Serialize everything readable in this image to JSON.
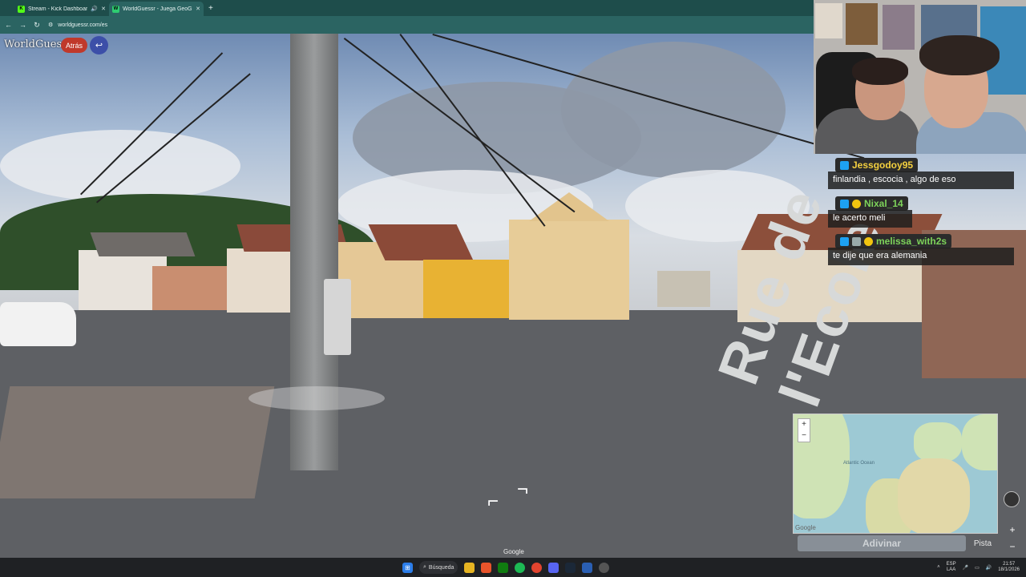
{
  "browser": {
    "tabs": [
      {
        "label": "Stream - Kick Dashboard",
        "favicon": "K",
        "favicon_color": "#53fc18",
        "active": false
      },
      {
        "label": "WorldGuessr - Juega GeoGuessr",
        "favicon": "W",
        "favicon_color": "#2ecc71",
        "active": true
      }
    ],
    "new_tab": "+",
    "url": "worldguessr.com/es"
  },
  "game": {
    "logo": "WorldGuessr",
    "back_label": "Atrás",
    "undo_icon": "↩",
    "street_name": "Rue de l'Ecole",
    "google_watermark": "Google",
    "guess_label": "Adivinar",
    "hint_label": "Pista",
    "map_attribution": "Google",
    "zoom_in": "+",
    "zoom_out": "−",
    "map_labels": [
      "Atlantic Ocean"
    ]
  },
  "chat": [
    {
      "user": "Jessgodoy95",
      "message": "finlandia , escocia , algo de eso",
      "color": "#f4d03f"
    },
    {
      "user": "Nixal_14",
      "message": "le acerto meli",
      "color": "#7dd35a"
    },
    {
      "user": "melissa_with2s",
      "message": "te dije que era alemania",
      "color": "#7dd35a"
    }
  ],
  "taskbar": {
    "search_label": "Búsqueda",
    "lang_top": "ESP",
    "lang_bottom": "LAA",
    "time": "21:57",
    "date": "18/1/2026"
  }
}
